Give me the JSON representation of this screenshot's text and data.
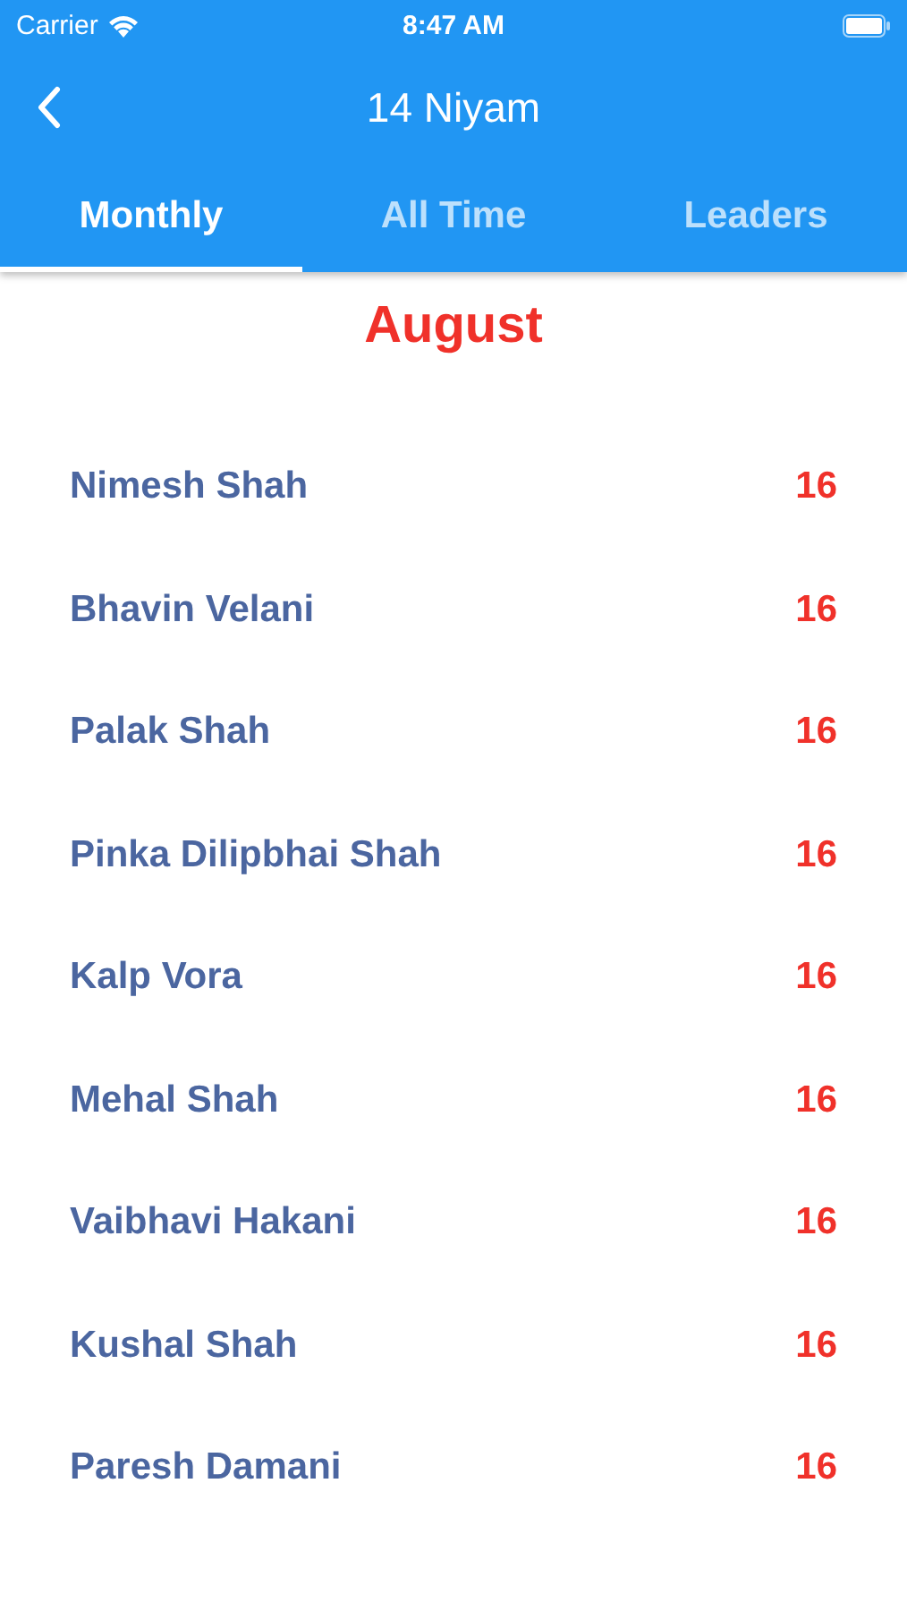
{
  "status_bar": {
    "carrier": "Carrier",
    "time": "8:47 AM"
  },
  "header": {
    "title": "14 Niyam"
  },
  "tabs": [
    {
      "label": "Monthly",
      "selected": true
    },
    {
      "label": "All Time",
      "selected": false
    },
    {
      "label": "Leaders",
      "selected": false
    }
  ],
  "month": "August",
  "rows": [
    {
      "name": "Nimesh Shah",
      "score": "16"
    },
    {
      "name": "Bhavin Velani",
      "score": "16"
    },
    {
      "name": "Palak Shah",
      "score": "16"
    },
    {
      "name": "Pinka Dilipbhai Shah",
      "score": "16"
    },
    {
      "name": "Kalp Vora",
      "score": "16"
    },
    {
      "name": "Mehal Shah",
      "score": "16"
    },
    {
      "name": "Vaibhavi Hakani",
      "score": "16"
    },
    {
      "name": "Kushal Shah",
      "score": "16"
    },
    {
      "name": "Paresh Damani",
      "score": "16"
    }
  ]
}
